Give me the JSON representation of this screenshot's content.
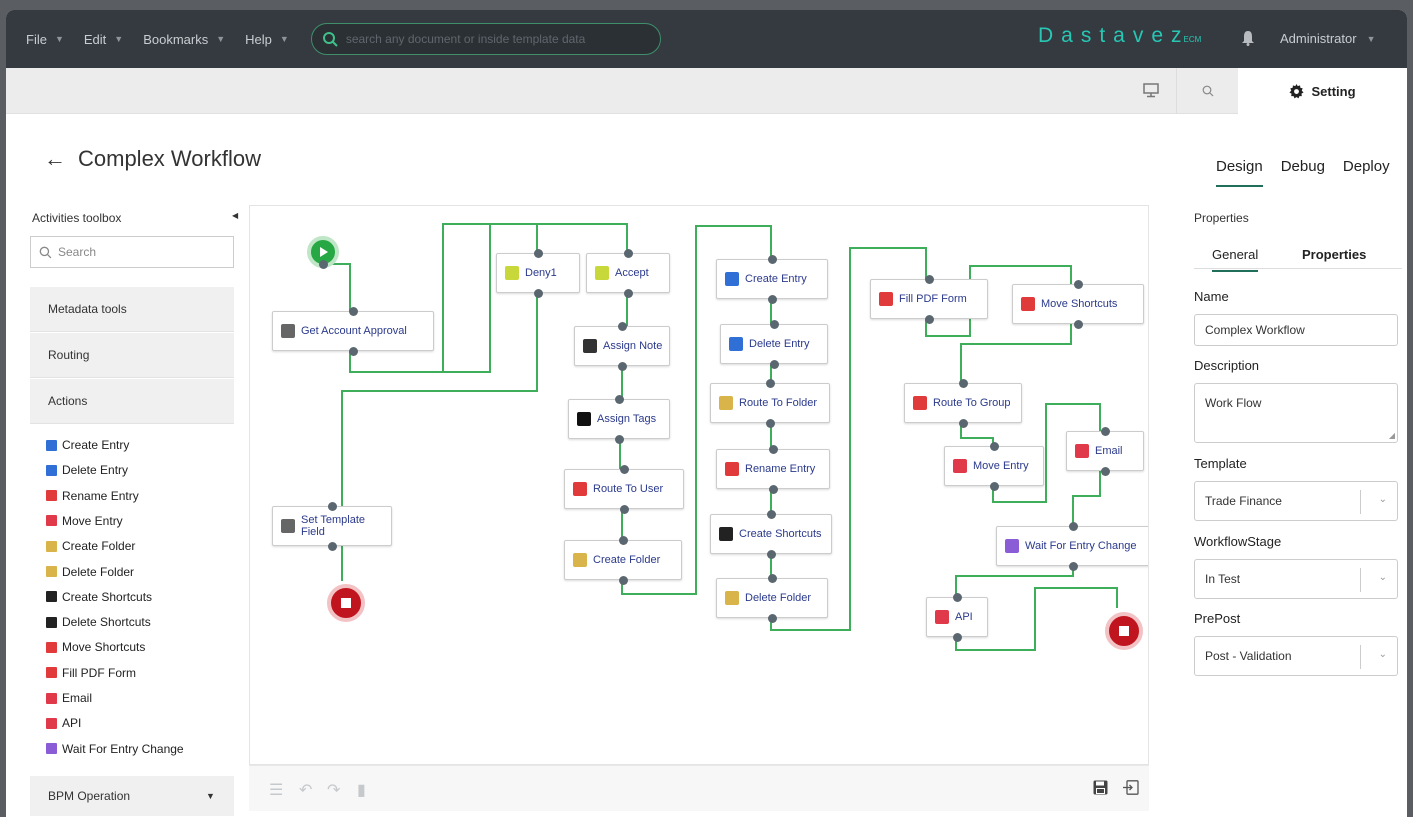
{
  "menubar": {
    "items": [
      "File",
      "Edit",
      "Bookmarks",
      "Help"
    ],
    "search_placeholder": "search any document or inside template data",
    "brand": "Dastavez",
    "brand_suffix": "ECM",
    "user": "Administrator"
  },
  "toolbar2": {
    "setting_label": "Setting"
  },
  "page": {
    "title": "Complex Workflow",
    "modes": [
      "Design",
      "Debug",
      "Deploy"
    ],
    "active_mode": "Design"
  },
  "toolbox": {
    "title": "Activities toolbox",
    "search_placeholder": "Search",
    "sections": [
      "Metadata tools",
      "Routing",
      "Actions"
    ],
    "actions": [
      {
        "label": "Create Entry",
        "icon": "create-entry-icon",
        "color": "#2f6fd6"
      },
      {
        "label": "Delete Entry",
        "icon": "delete-entry-icon",
        "color": "#2f6fd6"
      },
      {
        "label": "Rename Entry",
        "icon": "rename-entry-icon",
        "color": "#e03a3a"
      },
      {
        "label": "Move Entry",
        "icon": "move-entry-icon",
        "color": "#e03a4a"
      },
      {
        "label": "Create Folder",
        "icon": "create-folder-icon",
        "color": "#d9b44a"
      },
      {
        "label": "Delete Folder",
        "icon": "delete-folder-icon",
        "color": "#d9b44a"
      },
      {
        "label": "Create Shortcuts",
        "icon": "create-shortcuts-icon",
        "color": "#222222"
      },
      {
        "label": "Delete Shortcuts",
        "icon": "delete-shortcuts-icon",
        "color": "#222222"
      },
      {
        "label": "Move Shortcuts",
        "icon": "move-shortcuts-icon",
        "color": "#e03a3a"
      },
      {
        "label": "Fill PDF Form",
        "icon": "fill-pdf-icon",
        "color": "#e03a3a"
      },
      {
        "label": "Email",
        "icon": "email-icon",
        "color": "#e03a4a"
      },
      {
        "label": "API",
        "icon": "api-icon",
        "color": "#e03a4a"
      },
      {
        "label": "Wait For Entry Change",
        "icon": "wait-icon",
        "color": "#8a5cd6"
      }
    ],
    "bpm_label": "BPM Operation"
  },
  "workflow": {
    "nodes": [
      {
        "id": "get-account-approval",
        "label": "Get Account Approval",
        "icon": "template-icon",
        "color": "#666666"
      },
      {
        "id": "set-template-field",
        "label": "Set Template Field",
        "icon": "template-icon",
        "color": "#666666"
      },
      {
        "id": "deny1",
        "label": "Deny1",
        "icon": "deny-icon",
        "color": "#c8d83a"
      },
      {
        "id": "accept",
        "label": "Accept",
        "icon": "accept-icon",
        "color": "#c8d83a"
      },
      {
        "id": "assign-note",
        "label": "Assign Note",
        "icon": "note-icon",
        "color": "#333333"
      },
      {
        "id": "assign-tags",
        "label": "Assign Tags",
        "icon": "tag-icon",
        "color": "#111111"
      },
      {
        "id": "route-to-user",
        "label": "Route To User",
        "icon": "route-user-icon",
        "color": "#e03a3a"
      },
      {
        "id": "create-folder",
        "label": "Create Folder",
        "icon": "folder-icon",
        "color": "#d9b44a"
      },
      {
        "id": "create-entry",
        "label": "Create Entry",
        "icon": "create-entry-icon",
        "color": "#2f6fd6"
      },
      {
        "id": "delete-entry",
        "label": "Delete Entry",
        "icon": "delete-entry-icon",
        "color": "#2f6fd6"
      },
      {
        "id": "route-to-folder",
        "label": "Route To Folder",
        "icon": "route-folder-icon",
        "color": "#d9b44a"
      },
      {
        "id": "rename-entry",
        "label": "Rename Entry",
        "icon": "rename-entry-icon",
        "color": "#e03a3a"
      },
      {
        "id": "create-shortcuts",
        "label": "Create Shortcuts",
        "icon": "create-shortcuts-icon",
        "color": "#222222"
      },
      {
        "id": "delete-folder",
        "label": "Delete Folder",
        "icon": "delete-folder-icon",
        "color": "#d9b44a"
      },
      {
        "id": "fill-pdf-form",
        "label": "Fill PDF Form",
        "icon": "fill-pdf-icon",
        "color": "#e03a3a"
      },
      {
        "id": "move-shortcuts",
        "label": "Move Shortcuts",
        "icon": "move-shortcuts-icon",
        "color": "#e03a3a"
      },
      {
        "id": "route-to-group",
        "label": "Route To Group",
        "icon": "route-group-icon",
        "color": "#e03a3a"
      },
      {
        "id": "move-entry",
        "label": "Move Entry",
        "icon": "move-entry-icon",
        "color": "#e03a4a"
      },
      {
        "id": "email",
        "label": "Email",
        "icon": "email-icon",
        "color": "#e03a4a"
      },
      {
        "id": "wait-for-entry-change",
        "label": "Wait For Entry Change",
        "icon": "wait-icon",
        "color": "#8a5cd6"
      },
      {
        "id": "api",
        "label": "API",
        "icon": "api-icon",
        "color": "#e03a4a"
      }
    ],
    "wire_color": "#3fae5a"
  },
  "properties": {
    "title": "Properties",
    "tabs": [
      "General",
      "Properties"
    ],
    "active_tab": "General",
    "name_label": "Name",
    "name_value": "Complex Workflow",
    "description_label": "Description",
    "description_value": "Work Flow",
    "template_label": "Template",
    "template_value": "Trade Finance",
    "stage_label": "WorkflowStage",
    "stage_value": "In Test",
    "prepost_label": "PrePost",
    "prepost_value": "Post - Validation"
  }
}
